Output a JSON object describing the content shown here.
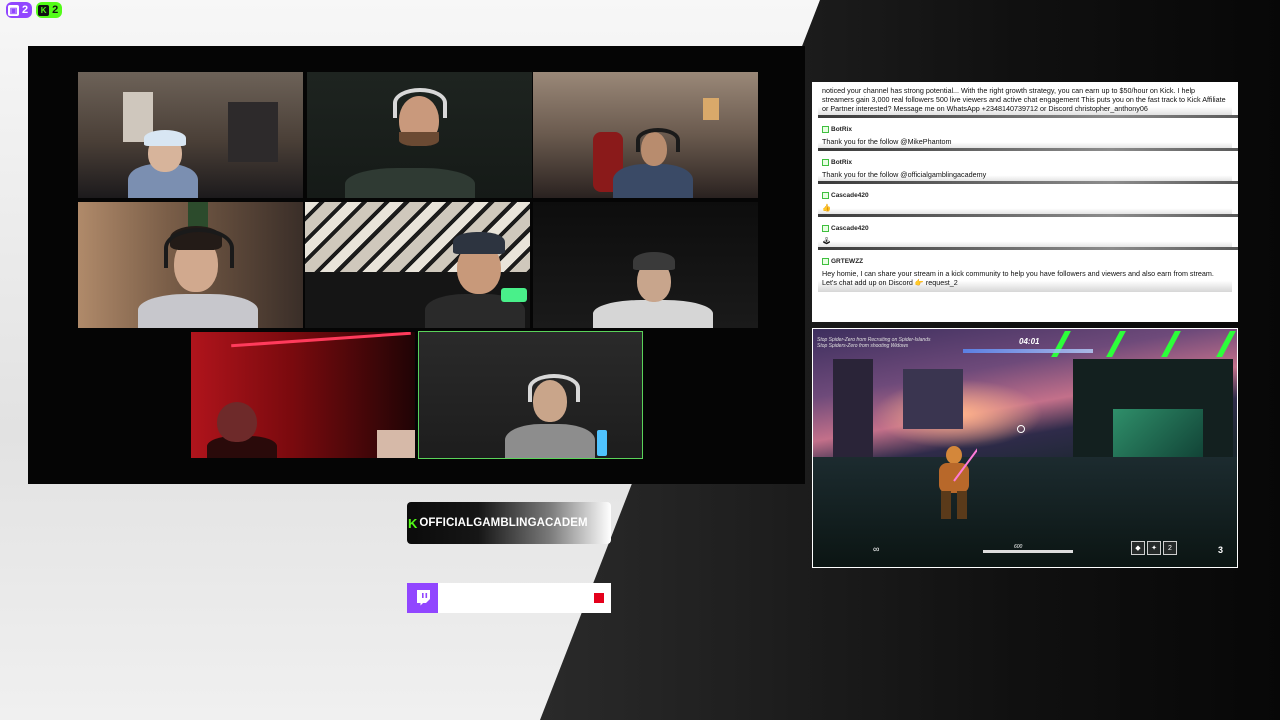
{
  "badges": {
    "twitch": {
      "icon": "twitch-icon",
      "count": "2",
      "color": "#9146ff"
    },
    "kick": {
      "icon": "kick-icon",
      "count": "2",
      "color": "#53fc18"
    }
  },
  "cameras": [
    {
      "id": "cam-1"
    },
    {
      "id": "cam-2"
    },
    {
      "id": "cam-3"
    },
    {
      "id": "cam-4"
    },
    {
      "id": "cam-5"
    },
    {
      "id": "cam-6"
    },
    {
      "id": "cam-7"
    },
    {
      "id": "cam-8",
      "active": true
    }
  ],
  "chat": {
    "messages": [
      {
        "user": "",
        "text": "noticed your channel has strong potential... With the right growth strategy, you can earn up to $50/hour on Kick. I help streamers gain 3,000 real followers 500 live viewers and active chat engagement This puts you on the fast track to Kick Affiliate or Partner interested? Message me on WhatsApp +2348140739712 or Discord christopher_anthony06"
      },
      {
        "user": "BotRix",
        "text": "Thank you for the follow @MikePhantom"
      },
      {
        "user": "BotRix",
        "text": "Thank you for the follow @officialgamblingacademy"
      },
      {
        "user": "Cascade420",
        "text": "👍"
      },
      {
        "user": "Cascade420",
        "text": "🕹"
      },
      {
        "user": "GRTEWZZ",
        "text": "Hey homie, I can share your stream in a kick community to help you have followers and viewers and also earn from stream. Let's chat add up on Discord 👉 request_2"
      }
    ]
  },
  "game": {
    "objective": "Stop Spider-Zero from Recruiting on Spider-Islands",
    "objective_sub": "Stop Spiders-Zero from shooting Widows",
    "timer": "04:01",
    "hp": "600",
    "ammo": "∞",
    "skill_count": "2",
    "ultimate": "3"
  },
  "plates": {
    "kick_logo": "K",
    "kick_name": "OFFICIALGAMBLINGACADEM",
    "twitch_icon": "twitch-icon",
    "live_color": "#e4001b"
  }
}
